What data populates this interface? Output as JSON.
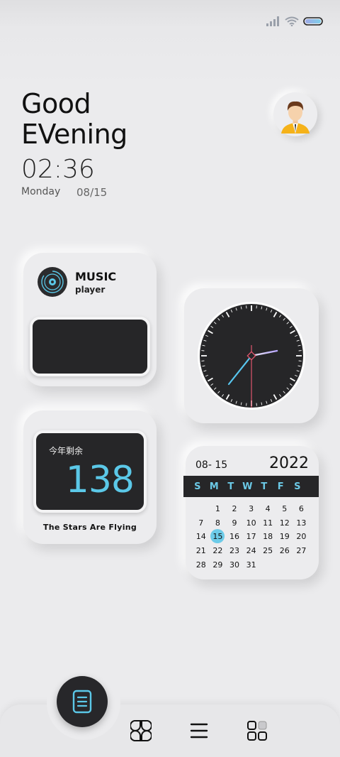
{
  "status_bar": {
    "icons": [
      "signal-icon",
      "wifi-icon",
      "battery-icon"
    ]
  },
  "header": {
    "greeting_line1": "Good",
    "greeting_line2": "EVening",
    "time": "02:36",
    "day": "Monday",
    "date": "08/15"
  },
  "music_widget": {
    "title": "MUSIC",
    "subtitle": "player"
  },
  "clock_widget": {
    "hour_hand_color": "#bfb0ff",
    "minute_hand_color": "#58c7f0",
    "second_hand_color": "#e0566d"
  },
  "countdown_widget": {
    "label": "今年剩余",
    "value": "138",
    "caption": "The Stars Are Flying"
  },
  "calendar_widget": {
    "date": "08- 15",
    "year": "2022",
    "weekdays": [
      "S",
      "M",
      "T",
      "W",
      "T",
      "F",
      "S"
    ],
    "today": "15",
    "weeks": [
      [
        "",
        "1",
        "2",
        "3",
        "4",
        "5",
        "6"
      ],
      [
        "7",
        "8",
        "9",
        "10",
        "11",
        "12",
        "13"
      ],
      [
        "14",
        "15",
        "16",
        "17",
        "18",
        "19",
        "20"
      ],
      [
        "21",
        "22",
        "23",
        "24",
        "25",
        "26",
        "27"
      ],
      [
        "28",
        "29",
        "30",
        "31",
        "",
        "",
        ""
      ]
    ]
  },
  "dock": {
    "items": [
      "notes-icon",
      "clover-apps-icon",
      "menu-icon",
      "grid-apps-icon"
    ]
  },
  "colors": {
    "accent": "#5bc8e8",
    "dark_panel": "#262628",
    "background": "#ebebed"
  }
}
